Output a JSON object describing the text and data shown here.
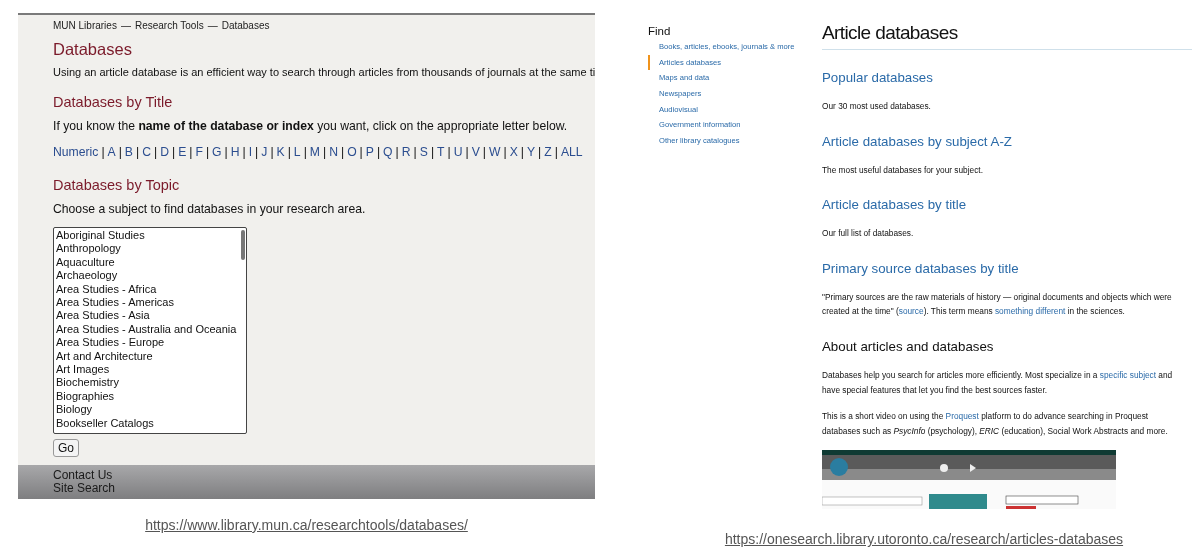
{
  "left_page": {
    "breadcrumb": [
      "MUN Libraries",
      "Research Tools",
      "Databases"
    ],
    "breadcrumb_separator": "—",
    "title": "Databases",
    "intro": "Using an article database is an efficient way to search through articles from thousands of journals at the same ti",
    "by_title": {
      "heading": "Databases by Title",
      "text": "If you know the **name of the database or index** you want, click on the appropriate letter below.",
      "letters": [
        "Numeric",
        "A",
        "B",
        "C",
        "D",
        "E",
        "F",
        "G",
        "H",
        "I",
        "J",
        "K",
        "L",
        "M",
        "N",
        "O",
        "P",
        "Q",
        "R",
        "S",
        "T",
        "U",
        "V",
        "W",
        "X",
        "Y",
        "Z",
        "ALL"
      ],
      "separator": "|"
    },
    "by_topic": {
      "heading": "Databases by Topic",
      "text": "Choose a subject to find databases in your research area.",
      "subjects": [
        "Aboriginal Studies",
        "Anthropology",
        "Aquaculture",
        "Archaeology",
        "Area Studies - Africa",
        "Area Studies - Americas",
        "Area Studies - Asia",
        "Area Studies - Australia and Oceania",
        "Area Studies - Europe",
        "Art and Architecture",
        "Art Images",
        "Biochemistry",
        "Biographies",
        "Biology",
        "Bookseller Catalogs"
      ],
      "button": "Go"
    },
    "footer_links": [
      "Contact Us",
      "Site Search"
    ],
    "caption": "https://www.library.mun.ca/researchtools/databases/"
  },
  "right_page": {
    "sidebar": {
      "heading": "Find",
      "items": [
        {
          "label": "Books, articles, ebooks, journals & more",
          "selected": false
        },
        {
          "label": "Articles databases",
          "selected": true
        },
        {
          "label": "Maps and data",
          "selected": false
        },
        {
          "label": "Newspapers",
          "selected": false
        },
        {
          "label": "Audiovisual",
          "selected": false
        },
        {
          "label": "Government information",
          "selected": false
        },
        {
          "label": "Other library catalogues",
          "selected": false
        }
      ]
    },
    "title": "Article databases",
    "blocks": [
      {
        "kind": "link-heading",
        "text": "Popular databases"
      },
      {
        "kind": "paragraph",
        "parts": [
          {
            "kind": "text",
            "text": "Our 30 most used databases."
          }
        ]
      },
      {
        "kind": "link-heading",
        "text": "Article databases by subject A-Z"
      },
      {
        "kind": "paragraph",
        "parts": [
          {
            "kind": "text",
            "text": "The most useful databases for your subject."
          }
        ]
      },
      {
        "kind": "link-heading",
        "text": "Article databases by title"
      },
      {
        "kind": "paragraph",
        "parts": [
          {
            "kind": "text",
            "text": "Our full list of databases."
          }
        ]
      },
      {
        "kind": "link-heading",
        "text": "Primary source databases by title"
      },
      {
        "kind": "paragraph",
        "parts": [
          {
            "kind": "text",
            "text": "\"Primary sources are the raw materials of history — original documents and objects which were created at the time\" ("
          },
          {
            "kind": "link",
            "text": "source"
          },
          {
            "kind": "text",
            "text": "). This term means "
          },
          {
            "kind": "link",
            "text": "something different"
          },
          {
            "kind": "text",
            "text": " in the sciences."
          }
        ]
      },
      {
        "kind": "heading",
        "text": "About articles and databases"
      },
      {
        "kind": "paragraph",
        "parts": [
          {
            "kind": "text",
            "text": "Databases help you search for articles more efficiently.  Most specialize in a "
          },
          {
            "kind": "link",
            "text": "specific subject"
          },
          {
            "kind": "text",
            "text": " and have special features that let you find the best sources faster."
          }
        ]
      },
      {
        "kind": "paragraph",
        "parts": [
          {
            "kind": "text",
            "text": "This is a short video on using the "
          },
          {
            "kind": "link",
            "text": "Proquest"
          },
          {
            "kind": "text",
            "text": " platform to do advance searching in Proquest databases such as *PsycInfo* (psychology), *ERIC* (education), Social Work Abstracts and more."
          }
        ]
      },
      {
        "kind": "video"
      }
    ],
    "caption": "https://onesearch.library.utoronto.ca/research/articles-databases"
  }
}
